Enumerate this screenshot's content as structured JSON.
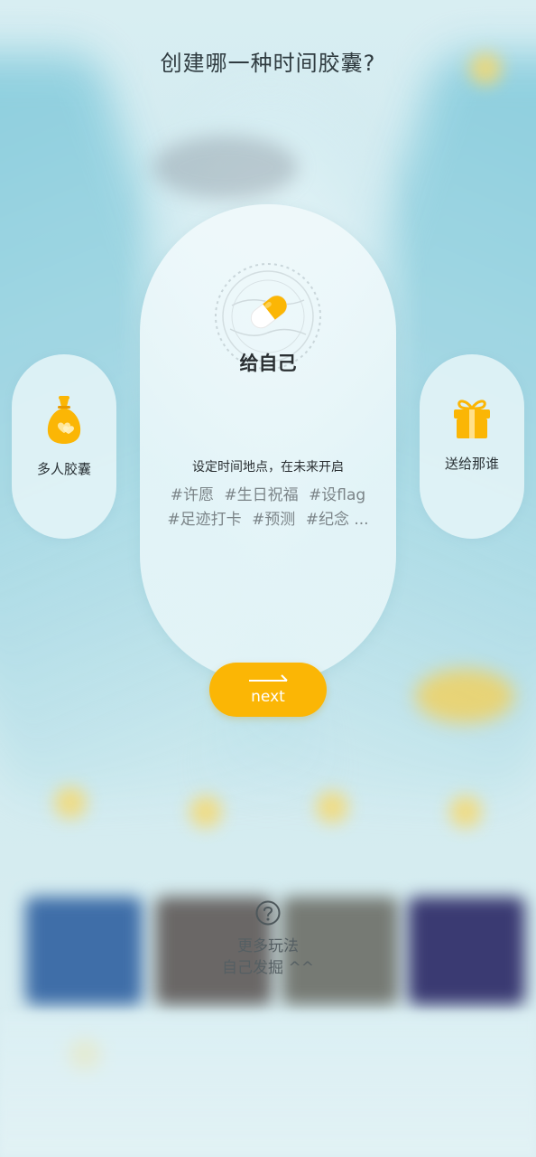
{
  "header": {
    "title": "创建哪一种时间胶囊?"
  },
  "options": {
    "left": {
      "label": "多人胶囊",
      "icon": "money-bag-hearts-icon"
    },
    "center": {
      "label": "给自己",
      "icon": "capsule-pill-icon",
      "description": "设定时间地点，在未来开启",
      "tags_row1": [
        "#许愿",
        "#生日祝福",
        "#设flag"
      ],
      "tags_row2": [
        "#足迹打卡",
        "#预测",
        "#纪念 ..."
      ]
    },
    "right": {
      "label": "送给那谁",
      "icon": "gift-box-icon"
    }
  },
  "next_button": {
    "label": "next",
    "icon": "right-arrow-icon"
  },
  "more": {
    "icon": "question-circle-icon",
    "line1": "更多玩法",
    "line2": "自己发掘 ^^"
  },
  "colors": {
    "accent": "#fbb605",
    "background": "#cfe9ef",
    "card": "#ecf7f9",
    "title_text": "#2f3b40",
    "tag_text": "#7b8488"
  }
}
